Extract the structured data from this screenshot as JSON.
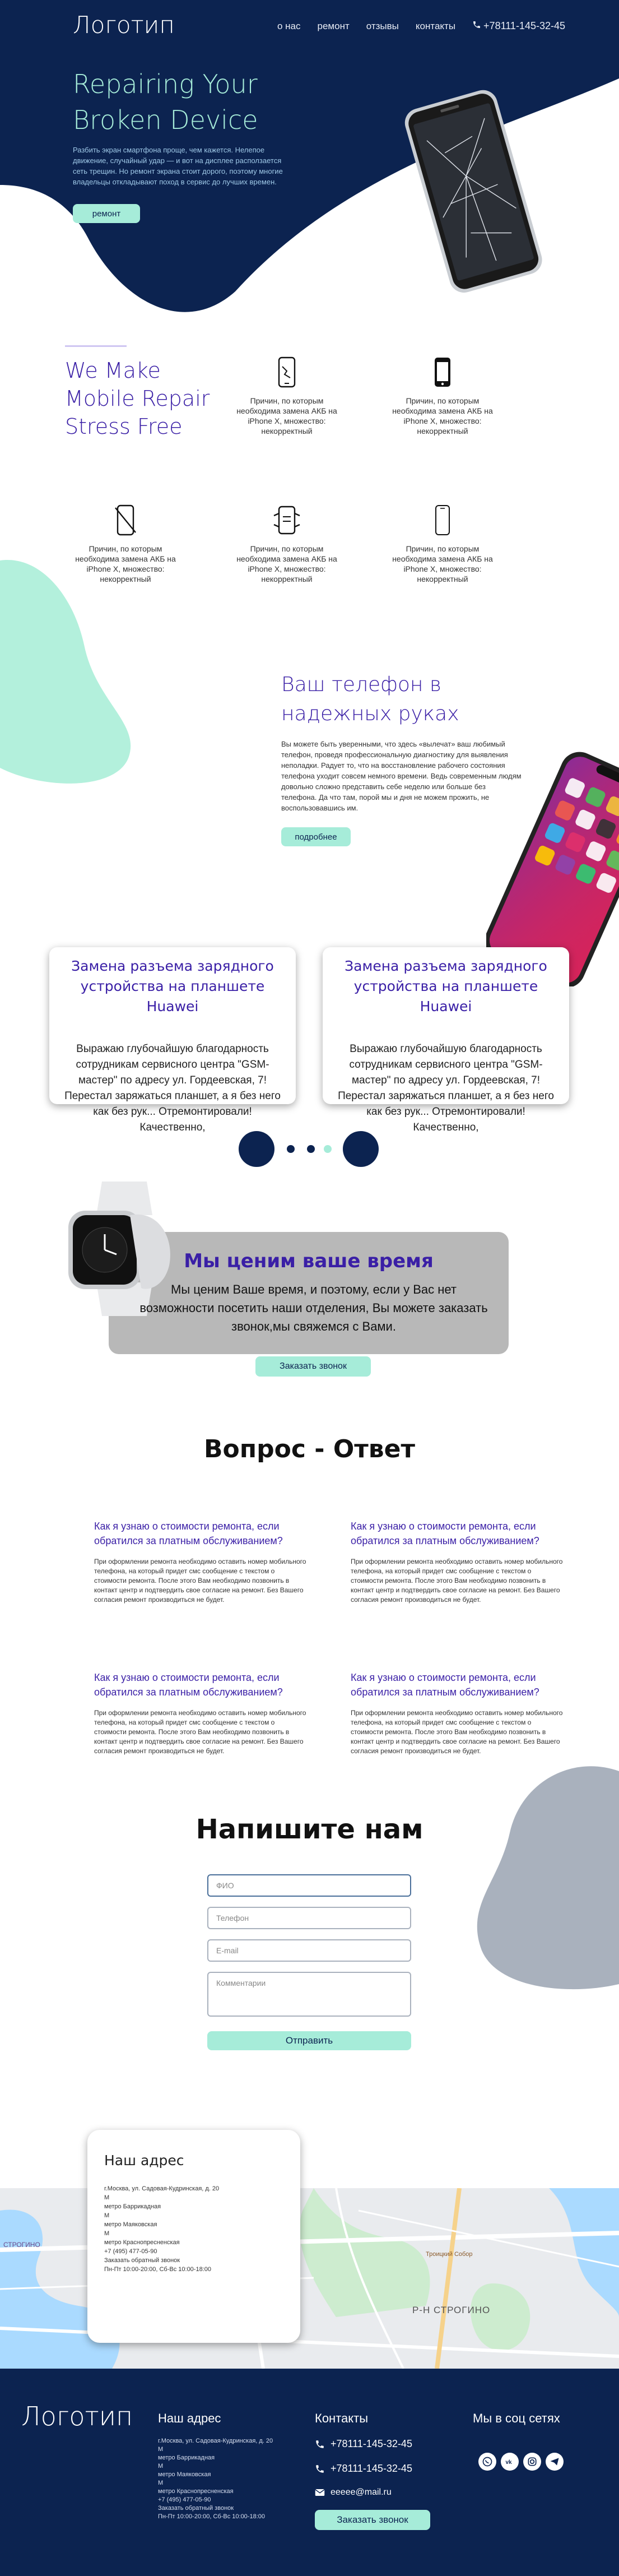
{
  "header": {
    "logo": "Логотип",
    "nav": [
      "о нас",
      "ремонт",
      "отзывы",
      "контакты"
    ],
    "phone": "+78111-145-32-45"
  },
  "hero": {
    "title": "Repairing Your Broken Device",
    "text": "Разбить экран смартфона проще, чем кажется. Нелепое движение, случайный удар — и вот на дисплее расползается сеть трещин. Но ремонт экрана стоит дорого, поэтому многие владельцы откладывают поход в сервис до лучших времен.",
    "button": "ремонт"
  },
  "features": {
    "title": "We Make Mobile Repair Stress Free",
    "items": [
      {
        "icon": "broken-phone-icon",
        "text": "Причин, по которым необходима замена АКБ на iPhone X, множество: некорректный"
      },
      {
        "icon": "smartphone-icon",
        "text": "Причин, по которым необходима замена АКБ на iPhone X, множество: некорректный"
      },
      {
        "icon": "no-phone-icon",
        "text": "Причин, по которым необходима замена АКБ на iPhone X, множество: некорректный"
      },
      {
        "icon": "phone-repair-icon",
        "text": "Причин, по которым необходима замена АКБ на iPhone X, множество: некорректный"
      },
      {
        "icon": "phone-outline-icon",
        "text": "Причин, по которым необходима замена АКБ на iPhone X, множество: некорректный"
      }
    ]
  },
  "safe": {
    "title": "Ваш телефон в надежных руках",
    "text": "Вы можете быть уверенными, что здесь «вылечат» ваш любимый телефон, проведя профессиональную диагностику для выявления неполадки. Радует то, что на восстановление рабочего состояния телефона уходит совсем немного времени. Ведь современным людям довольно сложно представить себе неделю или больше без телефона. Да что там, порой мы и дня не можем прожить, не воспользовавшись им.",
    "button": "подробнее"
  },
  "reviews": [
    {
      "title": "Замена разъема зарядного устройства на планшете Huawei",
      "text": "Выражаю глубочайшую благодарность сотрудникам сервисного центра \"GSM-мастер\" по адресу ул. Гордеевская, 7! Перестал заряжаться планшет, а я без него как без рук... Отремонтировали! Качественно,"
    },
    {
      "title": "Замена разъема зарядного устройства на планшете Huawei",
      "text": "Выражаю глубочайшую благодарность сотрудникам сервисного центра \"GSM-мастер\" по адресу ул. Гордеевская, 7! Перестал заряжаться планшет, а я без него как без рук... Отремонтировали! Качественно,"
    }
  ],
  "value": {
    "title": "Мы ценим ваше время",
    "text": "Мы ценим Ваше время, и поэтому, если у Вас нет возможности посетить наши отделения, Вы можете заказать звонок,мы свяжемся с Вами.",
    "button": "Заказать звонок"
  },
  "faq": {
    "title": "Вопрос - Ответ",
    "items": [
      {
        "q": "Как я узнаю о стоимости ремонта, если обратился за платным обслуживанием?",
        "a": "При оформлении ремонта необходимо оставить номер мобильного телефона, на который придет смс сообщение с текстом о стоимости ремонта. После этого Вам необходимо позвонить в контакт центр и подтвердить свое согласие на ремонт. Без Вашего согласия ремонт производиться не будет."
      },
      {
        "q": "Как я узнаю о стоимости ремонта, если обратился за платным обслуживанием?",
        "a": "При оформлении ремонта необходимо оставить номер мобильного телефона, на который придет смс сообщение с текстом о стоимости ремонта. После этого Вам необходимо позвонить в контакт центр и подтвердить свое согласие на ремонт. Без Вашего согласия ремонт производиться не будет."
      },
      {
        "q": "Как я узнаю о стоимости ремонта, если обратился за платным обслуживанием?",
        "a": "При оформлении ремонта необходимо оставить номер мобильного телефона, на который придет смс сообщение с текстом о стоимости ремонта. После этого Вам необходимо позвонить в контакт центр и подтвердить свое согласие на ремонт. Без Вашего согласия ремонт производиться не будет."
      },
      {
        "q": "Как я узнаю о стоимости ремонта, если обратился за платным обслуживанием?",
        "a": "При оформлении ремонта необходимо оставить номер мобильного телефона, на который придет смс сообщение с текстом о стоимости ремонта. После этого Вам необходимо позвонить в контакт центр и подтвердить свое согласие на ремонт. Без Вашего согласия ремонт производиться не будет."
      }
    ]
  },
  "form": {
    "title": "Напишите нам",
    "name_placeholder": "ФИО",
    "phone_placeholder": "Телефон",
    "email_placeholder": "E-mail",
    "comment_placeholder": "Комментарии",
    "submit": "Отправить"
  },
  "address": {
    "title": "Наш адрес",
    "lines": "г.Москва, ул. Садовая-Кудринская, д. 20\nМ\nметро Баррикадная\nМ\nметро Маяковская\nМ\nметро Краснопресненская\n+7 (495) 477-05-90\nЗаказать обратный звонок\nПн-Пт 10:00-20:00, Сб-Вс 10:00-18:00"
  },
  "map": {
    "labels": [
      "СТРОГИНО",
      "Р-Н СТРОГИНО",
      "Троицкий Собор"
    ]
  },
  "footer": {
    "logo": "Логотип",
    "address_title": "Наш адрес",
    "address_lines": "г.Москва, ул. Садовая-Кудринская, д. 20\nМ\nметро Баррикадная\nМ\nметро Маяковская\nМ\nметро Краснопресненская\n+7 (495) 477-05-90\nЗаказать обратный звонок\nПн-Пт 10:00-20:00, Сб-Вс 10:00-18:00",
    "contacts_title": "Контакты",
    "phone1": "+78111-145-32-45",
    "phone2": "+78111-145-32-45",
    "email": "eeeee@mail.ru",
    "social_title": "Мы в соц сетях",
    "social_icons": [
      "whatsapp-icon",
      "vk-icon",
      "instagram-icon",
      "telegram-icon"
    ],
    "button": "Заказать звонок"
  },
  "colors": {
    "navy": "#0c2350",
    "mint": "#a6ecd9",
    "purple": "#3a1fa6",
    "gray_blob": "#a9b1bd"
  }
}
